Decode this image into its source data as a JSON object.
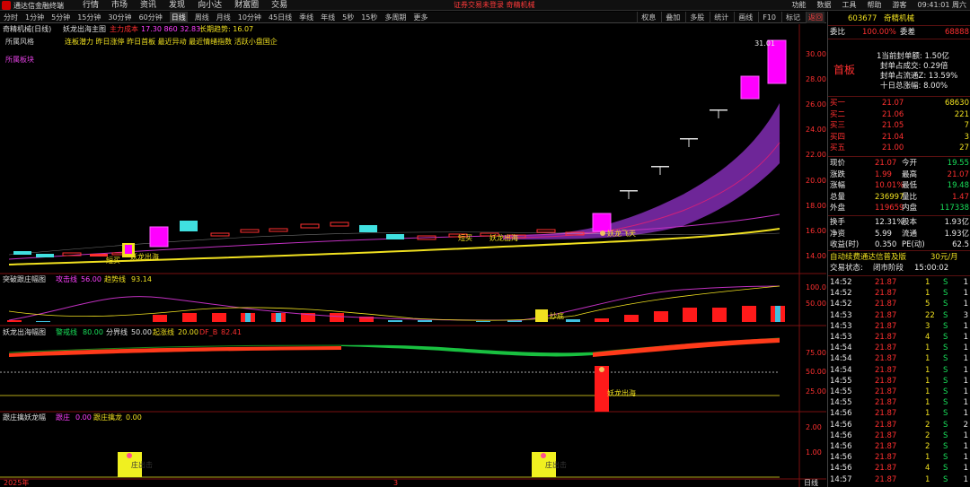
{
  "titlebar": {
    "app_title": "通达信金融终端",
    "menu": [
      "行情",
      "市场",
      "资讯",
      "发现",
      "向小达",
      "财富圈",
      "交易"
    ],
    "warning": "证券交易未登录  奇精机械",
    "right_items": [
      "功能",
      "数据",
      "工具",
      "帮助",
      "游客",
      "09:41:01 周六"
    ]
  },
  "toolbar": {
    "periods": [
      "分时",
      "1分钟",
      "5分钟",
      "15分钟",
      "30分钟",
      "60分钟",
      "日线",
      "周线",
      "月线",
      "10分钟",
      "45日线",
      "季线",
      "年线",
      "5秒",
      "15秒",
      "多周期",
      "更多"
    ],
    "active_period": "日线",
    "tools": [
      "权息",
      "叠加",
      "多股",
      "统计",
      "画线",
      "F10",
      "标记",
      "返回"
    ]
  },
  "main_panel": {
    "stock_label": "奇精机械(日线)",
    "indicator_name": "妖龙出海主图",
    "legend_1_label": "主力成本",
    "legend_1_values": "17.30 860 32.83",
    "legend_2": "长期趋势: 16.07",
    "risk_text": "所属风格",
    "styles": "连板潜力 昨日涨停 昨日首板 最近异动 最近情绪指数 活跃小盘国企",
    "section_text": "所属板块",
    "price_axis": [
      "30.00",
      "28.00",
      "26.00",
      "24.00",
      "22.00",
      "20.00",
      "18.00",
      "16.00",
      "14.00"
    ],
    "high_label": "31.01",
    "ann_yaolong": "妖龙出海",
    "ann_feitian": "妖龙飞天",
    "ann_duanfeng": "短买",
    "ann_left": "短买",
    "ann_left2": "妖龙出海"
  },
  "panel2": {
    "name": "突破跟庄幅图",
    "l1_label": "攻击线",
    "l1_value": "56.00",
    "l2_label": "趋势线",
    "l2_value": "93.14",
    "axis": [
      "100.0",
      "50.00"
    ],
    "ann": "抄底"
  },
  "panel3": {
    "name": "妖龙出海幅图",
    "l1_label": "警戒线",
    "l1_value": "80.00",
    "l2_label": "分界线",
    "l2_value": "50.00",
    "l3_label": "起涨线",
    "l3_value": "20.00",
    "l4_label": "DF_B",
    "l4_value": "82.41",
    "axis": [
      "75.00",
      "50.00",
      "25.00"
    ],
    "ann": "妖龙出海"
  },
  "panel4": {
    "name": "跟庄擒妖龙幅",
    "l1_label": "跟庄",
    "l1_value": "0.00",
    "l2_label": "跟庄擒龙",
    "l2_value": "0.00",
    "axis": [
      "2.00",
      "1.00"
    ],
    "ann": "庄出击",
    "year": "2025年",
    "month": "3",
    "axis_bottom": "日线"
  },
  "quote": {
    "code": "603677",
    "name": "奇精机械",
    "weibi_label": "委比",
    "weibi": "100.00%",
    "weicha_label": "委差",
    "weicha": "68888",
    "badge": "首板",
    "seal_lines": [
      "1当前封单额: 1.50亿",
      "封单占成交: 0.29倍",
      "封单占流通Z: 13.59%",
      "十日总涨幅: 8.00%"
    ],
    "buy": [
      {
        "label": "买一",
        "price": "21.07",
        "vol": "68630"
      },
      {
        "label": "买二",
        "price": "21.06",
        "vol": "221"
      },
      {
        "label": "买三",
        "price": "21.05",
        "vol": "7"
      },
      {
        "label": "买四",
        "price": "21.04",
        "vol": "3"
      },
      {
        "label": "买五",
        "price": "21.00",
        "vol": "27"
      }
    ],
    "stats": [
      [
        "现价",
        "21.07",
        "今开",
        "19.55"
      ],
      [
        "涨跌",
        "1.99",
        "最高",
        "21.07"
      ],
      [
        "涨幅",
        "10.01%",
        "最低",
        "19.48"
      ],
      [
        "总量",
        "236997",
        "量比",
        "1.47"
      ],
      [
        "外盘",
        "119659",
        "内盘",
        "117338"
      ]
    ],
    "stats2": [
      [
        "换手",
        "12.31%",
        "股本",
        "1.93亿"
      ],
      [
        "净资",
        "5.99",
        "流通",
        "1.93亿"
      ],
      [
        "收益(时)",
        "0.350",
        "PE(动)",
        "62.5"
      ]
    ],
    "ad": "自动续费通达信普及版",
    "ad_price": "30元/月",
    "status_label": "交易状态:",
    "status": "闭市阶段",
    "status_time": "15:00:02",
    "ticks": [
      [
        "14:52",
        "21.87",
        "1",
        "S",
        "1"
      ],
      [
        "14:52",
        "21.87",
        "1",
        "S",
        "1"
      ],
      [
        "14:52",
        "21.87",
        "5",
        "S",
        "1"
      ],
      [
        "14:53",
        "21.87",
        "22",
        "S",
        "3"
      ],
      [
        "14:53",
        "21.87",
        "3",
        "S",
        "1"
      ],
      [
        "14:53",
        "21.87",
        "4",
        "S",
        "1"
      ],
      [
        "14:54",
        "21.87",
        "1",
        "S",
        "1"
      ],
      [
        "14:54",
        "21.87",
        "1",
        "S",
        "1"
      ],
      [
        "14:54",
        "21.87",
        "1",
        "S",
        "1"
      ],
      [
        "14:55",
        "21.87",
        "1",
        "S",
        "1"
      ],
      [
        "14:55",
        "21.87",
        "1",
        "S",
        "1"
      ],
      [
        "14:55",
        "21.87",
        "1",
        "S",
        "1"
      ],
      [
        "14:56",
        "21.87",
        "1",
        "S",
        "1"
      ],
      [
        "14:56",
        "21.87",
        "2",
        "S",
        "2"
      ],
      [
        "14:56",
        "21.87",
        "2",
        "S",
        "1"
      ],
      [
        "14:56",
        "21.87",
        "2",
        "S",
        "1"
      ],
      [
        "14:56",
        "21.87",
        "1",
        "S",
        "1"
      ],
      [
        "14:56",
        "21.87",
        "4",
        "S",
        "1"
      ],
      [
        "14:57",
        "21.87",
        "1",
        "S",
        "1"
      ]
    ]
  },
  "colors": {
    "up": "#ff3030",
    "down": "#19e05a",
    "bg": "#000000",
    "yellow": "#f0e020",
    "magenta": "#ff00ff",
    "cyan": "#00e0e0",
    "purple": "#8a2be2"
  }
}
